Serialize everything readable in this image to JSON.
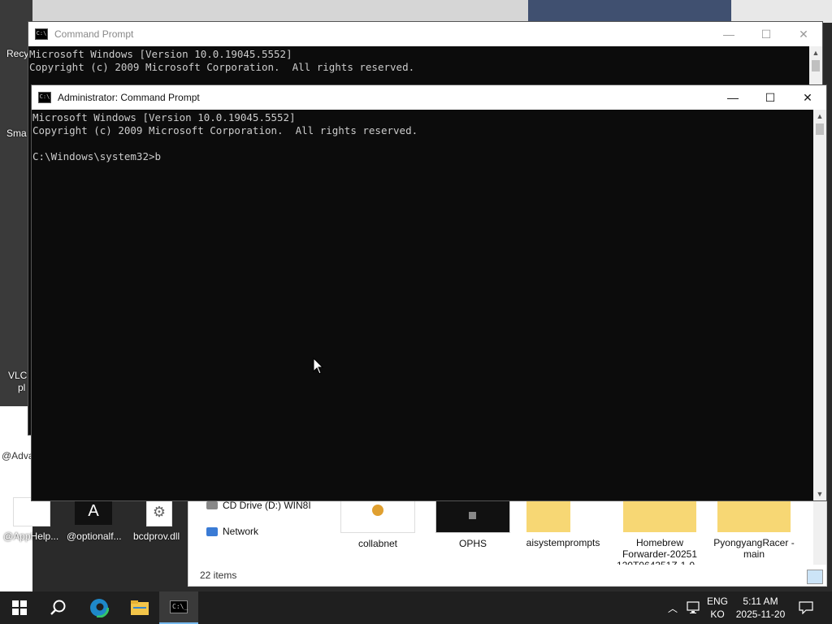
{
  "desktop": {
    "icons": [
      {
        "label": "Recy",
        "name": "recycle-bin-icon"
      },
      {
        "label": "Sma",
        "name": "smart-app-icon"
      },
      {
        "label": "VLC",
        "name": "vlc-icon"
      },
      {
        "label": "pl",
        "name": "vlc-label-part"
      },
      {
        "label": "@Adva",
        "name": "advanced-file-icon"
      },
      {
        "label": "@AppHelp...",
        "name": "apphelp-file-icon"
      },
      {
        "label": "@optionalf...",
        "name": "optionalfeatures-file-icon"
      },
      {
        "label": "bcdprov.dll",
        "name": "bcdprov-dll-icon"
      }
    ]
  },
  "cmd_back": {
    "title": "Command Prompt",
    "lines": [
      "Microsoft Windows [Version 10.0.19045.5552]",
      "Copyright (c) 2009 Microsoft Corporation.  All rights reserved."
    ]
  },
  "cmd_front": {
    "title": "Administrator: Command Prompt",
    "lines": [
      "Microsoft Windows [Version 10.0.19045.5552]",
      "Copyright (c) 2009 Microsoft Corporation.  All rights reserved.",
      "",
      "C:\\Windows\\system32>b"
    ]
  },
  "explorer": {
    "nav": [
      {
        "label": "CD Drive (D:) WIN8I",
        "icon": "cd-drive-icon"
      },
      {
        "label": "Network",
        "icon": "network-icon"
      }
    ],
    "files": [
      {
        "label": "collabnet",
        "icon": "certificate-file-icon"
      },
      {
        "label": "OPHS",
        "icon": "app-file-icon"
      },
      {
        "label": "aisystemprompts",
        "icon": "folder-icon"
      },
      {
        "label": "Homebrew Forwarder-20251 120T064351Z-1-0...",
        "icon": "folder-icon"
      },
      {
        "label": "PyongyangRacer -main",
        "icon": "folder-icon"
      }
    ],
    "status": "22 items"
  },
  "taskbar": {
    "lang_top": "ENG",
    "lang_bottom": "KO",
    "time": "5:11 AM",
    "date": "2025-11-20"
  }
}
